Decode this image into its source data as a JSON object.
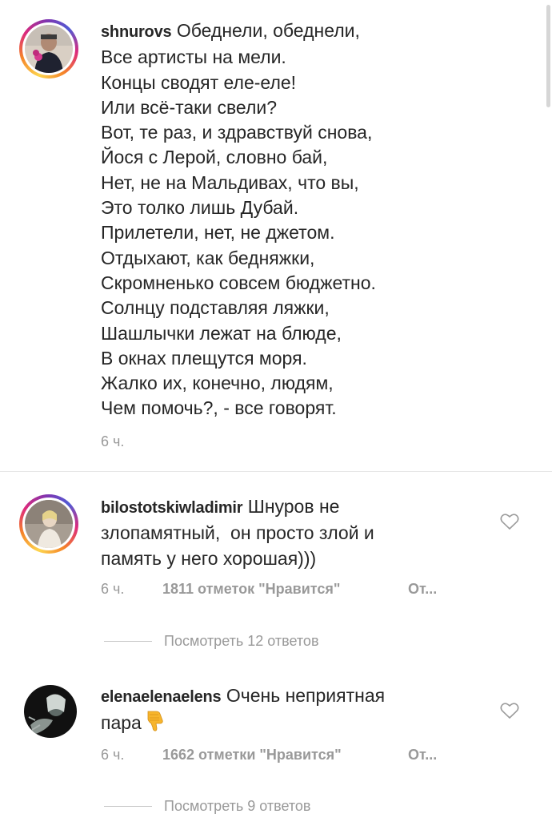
{
  "post": {
    "username": "shnurovs",
    "first_line": "Обеднели, обеднели,",
    "lines": [
      "Все артисты на мели.",
      "Концы сводят еле-еле!",
      "Или всё-таки свели?",
      "Вот, те раз, и здравствуй снова,",
      "Йося с Лерой, словно бай,",
      "Нет, не на Мальдивах, что вы,",
      "Это толко лишь Дубай.",
      "Прилетели, нет, не джетом.",
      "Отдыхают, как бедняжки,",
      "Скромненько совсем бюджетно.",
      "Солнцу подставляя ляжки,",
      "Шашлычки лежат на блюде,",
      "В окнах плещутся моря.",
      "Жалко их, конечно, людям,",
      "Чем помочь?, - все говорят."
    ],
    "time": "6 ч."
  },
  "comments": [
    {
      "username": "bilostotskiwladimir",
      "text_line1": "Шнуров не",
      "text_line2": "злопамятный,  он просто злой и",
      "text_line3": "память у него хорошая)))",
      "time": "6 ч.",
      "likes": "1811 отметок \"Нравится\"",
      "reply": "От...",
      "view_replies": "Посмотреть 12 ответов"
    },
    {
      "username": "elenaelenaelens",
      "text_line1": "Очень неприятная",
      "text_line2": "пара",
      "emoji": "thumbs-down",
      "time": "6 ч.",
      "likes": "1662 отметки \"Нравится\"",
      "reply": "От...",
      "view_replies": "Посмотреть 9 ответов"
    }
  ],
  "icons": {
    "like": "heart-outline-icon",
    "reaction": "thumbs-down-icon"
  },
  "colors": {
    "text": "#262626",
    "meta": "#999999",
    "emoji": "#f7b52c"
  }
}
